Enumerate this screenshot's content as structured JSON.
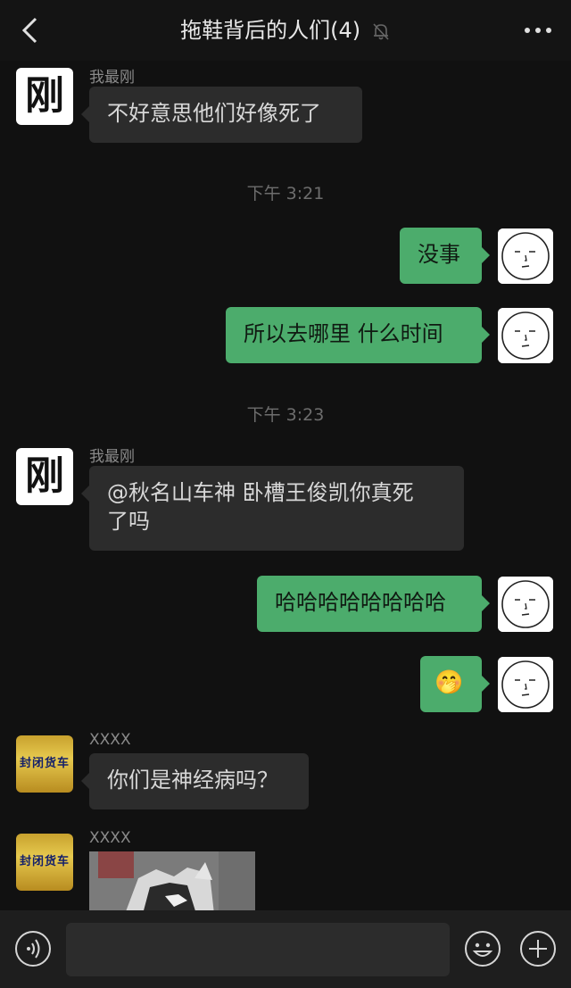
{
  "header": {
    "title": "拖鞋背后的人们",
    "member_count": "(4)",
    "back_icon": "chevron-left-icon",
    "mute_icon": "bell-off-icon",
    "more_icon": "more-dots-icon"
  },
  "messages": [
    {
      "sender": "我最刚",
      "avatar_char": "刚",
      "text": "不好意思他们好像死了"
    },
    {
      "time": "下午 3:21"
    },
    {
      "text": "没事"
    },
    {
      "text": "所以去哪里 什么时间"
    },
    {
      "time": "下午 3:23"
    },
    {
      "sender": "我最刚",
      "avatar_char": "刚",
      "text_line1": "@秋名山车神 卧槽王俊凯你真死",
      "text_line2": "了吗"
    },
    {
      "text": "哈哈哈哈哈哈哈哈"
    },
    {
      "emoji": "🤭"
    },
    {
      "sender": "XXXX",
      "avatar_text": "封闭货车",
      "text": "你们是神经病吗？"
    },
    {
      "sender": "XXXX",
      "avatar_text": "封闭货车",
      "image": "husky-photo"
    }
  ],
  "bottom_bar": {
    "voice_icon": "voice-icon",
    "emoji_icon": "emoji-icon",
    "plus_icon": "plus-icon"
  },
  "colors": {
    "background": "#111111",
    "bubble_out": "#4cac6c",
    "bubble_in": "#2c2c2c",
    "timestamp": "#6d6d6d"
  }
}
